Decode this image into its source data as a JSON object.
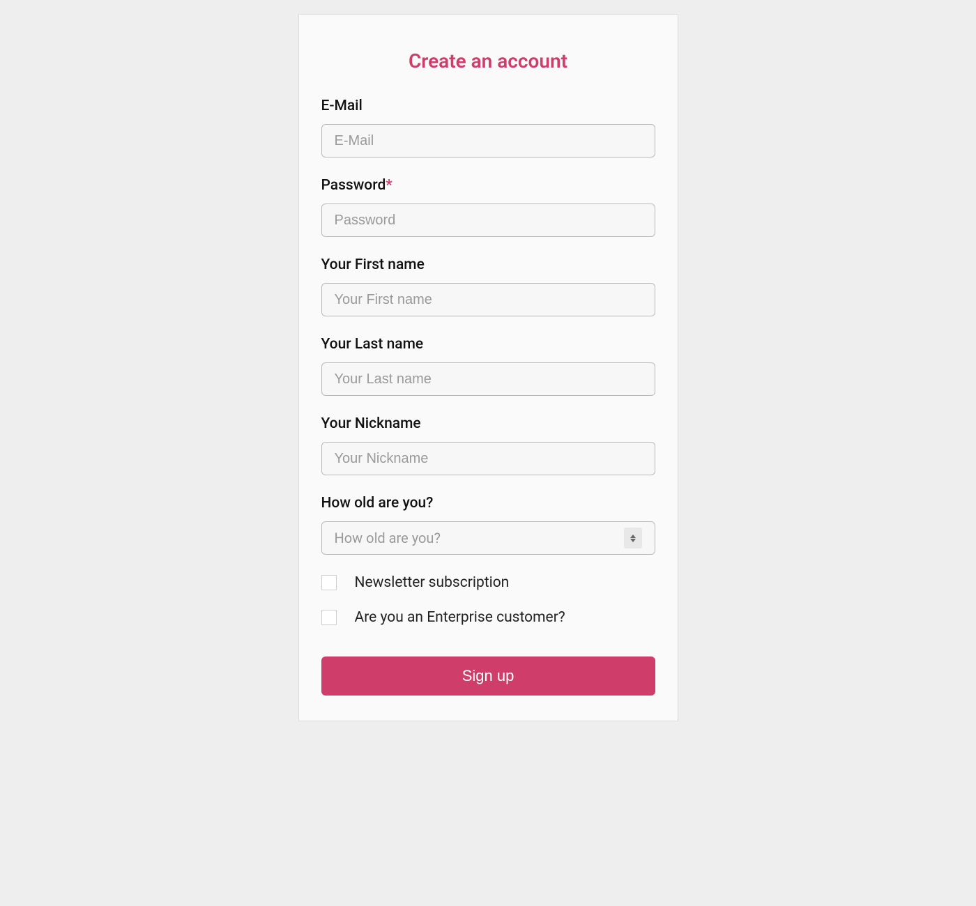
{
  "title": "Create an account",
  "fields": {
    "email": {
      "label": "E-Mail",
      "placeholder": "E-Mail",
      "required": false
    },
    "password": {
      "label": "Password",
      "placeholder": "Password",
      "required": true
    },
    "firstname": {
      "label": "Your First name",
      "placeholder": "Your First name",
      "required": false
    },
    "lastname": {
      "label": "Your Last name",
      "placeholder": "Your Last name",
      "required": false
    },
    "nickname": {
      "label": "Your Nickname",
      "placeholder": "Your Nickname",
      "required": false
    },
    "age": {
      "label": "How old are you?",
      "placeholder": "How old are you?",
      "required": false
    }
  },
  "checkboxes": {
    "newsletter": {
      "label": "Newsletter subscription",
      "checked": false
    },
    "enterprise": {
      "label": "Are you an Enterprise customer?",
      "checked": false
    }
  },
  "submit_label": "Sign up",
  "required_marker": "*",
  "colors": {
    "accent": "#cf3d6b"
  }
}
